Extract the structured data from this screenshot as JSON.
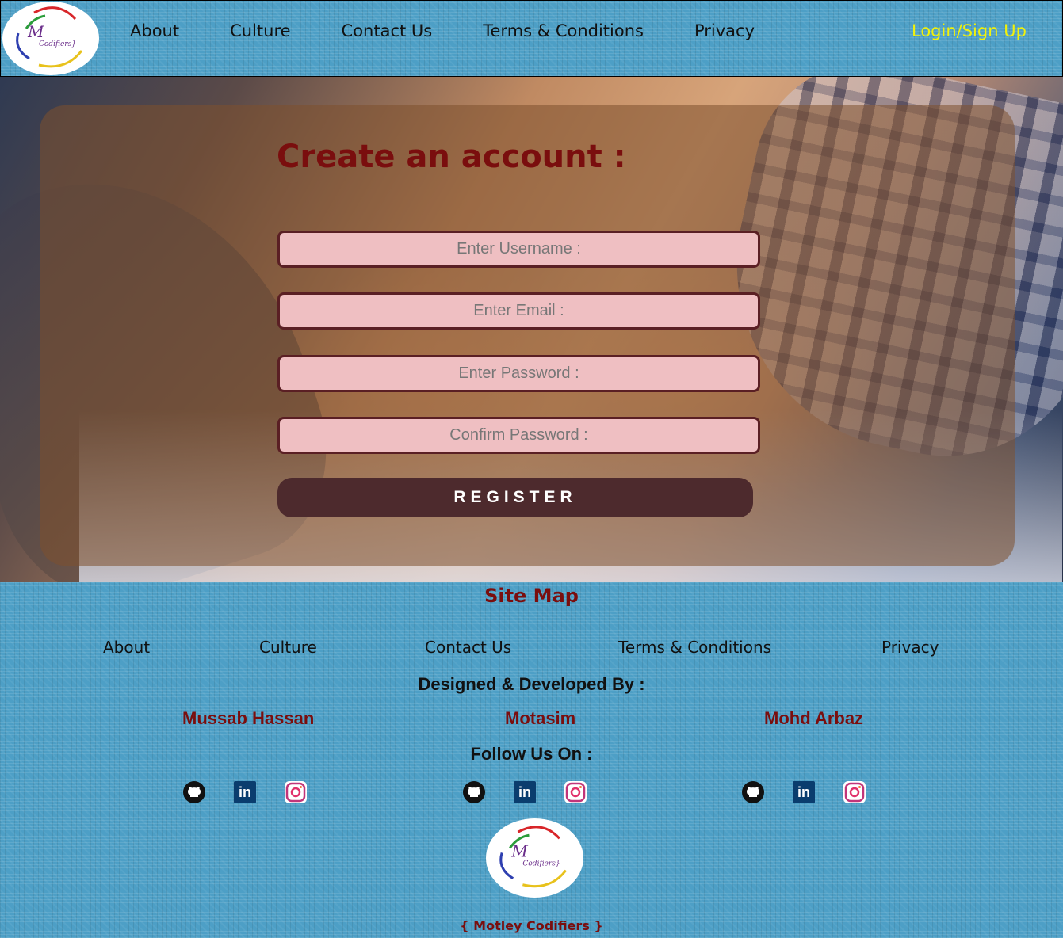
{
  "nav": {
    "links": [
      "About",
      "Culture",
      "Contact Us",
      "Terms & Conditions",
      "Privacy"
    ],
    "login": "Login/Sign Up",
    "logo_text": "</M Codifiers}"
  },
  "form": {
    "title": "Create an account :",
    "username_placeholder": "Enter Username :",
    "email_placeholder": "Enter Email :",
    "password_placeholder": "Enter Password :",
    "confirm_placeholder": "Confirm Password :",
    "register_label": "REGISTER"
  },
  "footer": {
    "sitemap_title": "Site Map",
    "links": [
      "About",
      "Culture",
      "Contact Us",
      "Terms & Conditions",
      "Privacy"
    ],
    "designed_by": "Designed & Developed By :",
    "developers": [
      "Mussab Hassan",
      "Motasim",
      "Mohd Arbaz"
    ],
    "follow": "Follow Us On :",
    "social_icons": [
      "github-icon",
      "linkedin-icon",
      "instagram-icon"
    ],
    "brand": "{ Motley Codifiers }"
  },
  "colors": {
    "nav_bg": "#4d9fc6",
    "login": "#f2f20a",
    "title": "#7a0e0e",
    "field_bg": "#efbfc2",
    "button_bg": "#4d2a2d"
  }
}
